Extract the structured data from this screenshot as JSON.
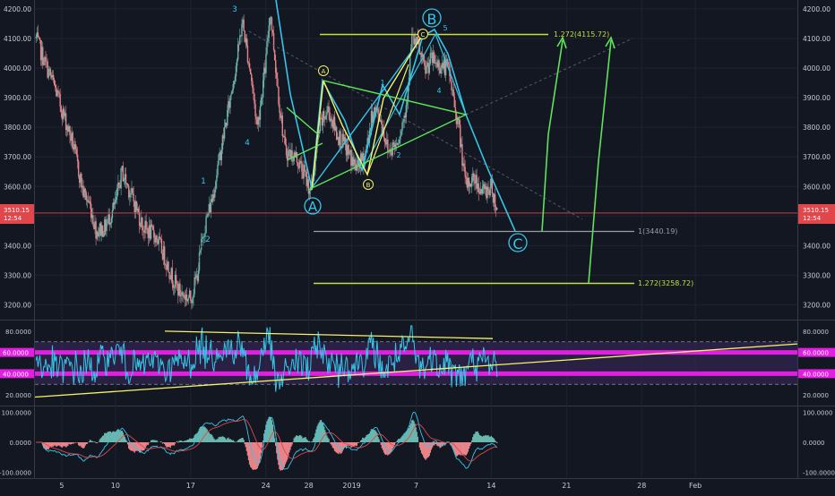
{
  "colors": {
    "background": "#131722",
    "grid": "#1f2331",
    "axis_text": "#c8cad2",
    "candle_up": "#6bb6ad",
    "candle_down": "#e7848a",
    "price_line": "#e0464a",
    "cyan": "#36c5e8",
    "yellow": "#f5f26b",
    "green": "#5ee35a",
    "olive": "#c6df3a",
    "gray": "#9a9ca3",
    "magenta": "#e11ee1",
    "rsi_fill": "#3c2a5e",
    "macd_line": "#36c5e8",
    "signal_line": "#e0464a"
  },
  "current_price": {
    "label": "3510.15",
    "countdown": "12:54",
    "value": 3510.15
  },
  "chart_data": [
    {
      "type": "candlestick",
      "panel": "price",
      "ylim": [
        3150,
        4230
      ],
      "y_ticks": [
        3200,
        3300,
        3400,
        3500,
        3600,
        3700,
        3800,
        3900,
        4000,
        4100,
        4200
      ],
      "y_tick_labels": [
        "3200.00",
        "3300.00",
        "3400.00",
        "3500.00",
        "3600.00",
        "3700.00",
        "3800.00",
        "3900.00",
        "4000.00",
        "4100.00",
        "4200.00"
      ],
      "x_labels": [
        "5",
        "10",
        "17",
        "24",
        "28",
        "2019",
        "7",
        "14",
        "21",
        "28",
        "Feb"
      ],
      "x_label_days": [
        5,
        10,
        17,
        24,
        28,
        32,
        38,
        45,
        52,
        59,
        64
      ],
      "x_range_days": [
        2.5,
        73.5
      ],
      "path_points": [
        [
          2.6,
          4100
        ],
        [
          3.4,
          4020
        ],
        [
          4.2,
          3950
        ],
        [
          5,
          3860
        ],
        [
          6,
          3750
        ],
        [
          7,
          3580
        ],
        [
          7.6,
          3540
        ],
        [
          8.2,
          3450
        ],
        [
          9,
          3460
        ],
        [
          10,
          3540
        ],
        [
          10.6,
          3650
        ],
        [
          11.6,
          3560
        ],
        [
          12.6,
          3460
        ],
        [
          13.8,
          3430
        ],
        [
          14.6,
          3360
        ],
        [
          15.2,
          3300
        ],
        [
          16,
          3240
        ],
        [
          17,
          3220
        ],
        [
          17.6,
          3300
        ],
        [
          18.2,
          3450
        ],
        [
          19,
          3560
        ],
        [
          19.8,
          3720
        ],
        [
          20.6,
          3880
        ],
        [
          21.4,
          4050
        ],
        [
          21.8,
          4160
        ],
        [
          22.6,
          3980
        ],
        [
          23.2,
          3800
        ],
        [
          24,
          4020
        ],
        [
          24.4,
          4200
        ],
        [
          25.2,
          3900
        ],
        [
          25.8,
          3720
        ],
        [
          26.8,
          3700
        ],
        [
          27.6,
          3640
        ],
        [
          28.2,
          3580
        ],
        [
          29,
          3800
        ],
        [
          29.8,
          3860
        ],
        [
          30.6,
          3780
        ],
        [
          31.6,
          3720
        ],
        [
          32.4,
          3660
        ],
        [
          33.2,
          3700
        ],
        [
          34,
          3860
        ],
        [
          34.6,
          3840
        ],
        [
          35.4,
          3720
        ],
        [
          36.2,
          3750
        ],
        [
          37,
          3850
        ],
        [
          37.6,
          4100
        ],
        [
          38.2,
          4070
        ],
        [
          38.8,
          3990
        ],
        [
          39.4,
          4030
        ],
        [
          40.2,
          4010
        ],
        [
          41,
          4000
        ],
        [
          41.6,
          3870
        ],
        [
          42,
          3790
        ],
        [
          42.6,
          3600
        ],
        [
          43.4,
          3630
        ],
        [
          44.2,
          3580
        ],
        [
          45,
          3600
        ],
        [
          45.6,
          3510
        ]
      ],
      "annotations": {
        "wave_labels": [
          "3",
          "4",
          "1",
          "2",
          "A",
          "B",
          "C",
          "A",
          "B",
          "C",
          "1",
          "2",
          "4",
          "5"
        ],
        "fib_levels": [
          {
            "label": "1.272(4115.72)",
            "value": 4115.72
          },
          {
            "label": "1(3440.19)",
            "value": 3440.19
          },
          {
            "label": "1.272(3258.72)",
            "value": 3258.72
          }
        ]
      }
    },
    {
      "type": "line",
      "panel": "rsi",
      "ylim": [
        10,
        90
      ],
      "y_ticks": [
        20,
        40,
        60,
        80
      ],
      "y_tick_labels": [
        "20.0000",
        "40.0000",
        "60.0000",
        "80.0000"
      ],
      "bands": [
        30,
        70
      ],
      "highlight_levels": [
        {
          "label": "60.0000",
          "value": 60
        },
        {
          "label": "40.0000",
          "value": 40
        }
      ]
    },
    {
      "type": "line",
      "panel": "macd",
      "ylim": [
        -120,
        120
      ],
      "y_ticks": [
        -100,
        0,
        100
      ],
      "y_tick_labels": [
        "-100.0000",
        "0.0000",
        "100.0000"
      ]
    }
  ]
}
